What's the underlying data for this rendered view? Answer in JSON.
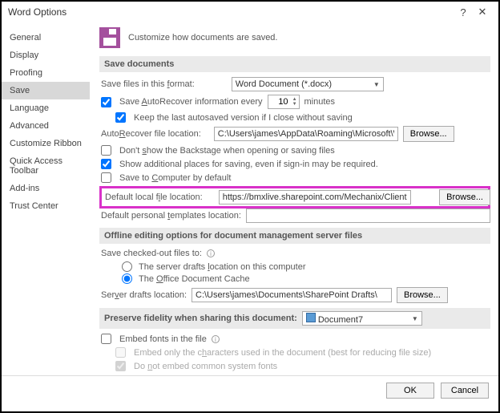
{
  "window": {
    "title": "Word Options"
  },
  "sidebar": {
    "items": [
      {
        "label": "General"
      },
      {
        "label": "Display"
      },
      {
        "label": "Proofing"
      },
      {
        "label": "Save"
      },
      {
        "label": "Language"
      },
      {
        "label": "Advanced"
      },
      {
        "label": "Customize Ribbon"
      },
      {
        "label": "Quick Access Toolbar"
      },
      {
        "label": "Add-ins"
      },
      {
        "label": "Trust Center"
      }
    ],
    "selected_index": 3
  },
  "header": {
    "text": "Customize how documents are saved."
  },
  "save_docs": {
    "title": "Save documents",
    "format_label": "Save files in this format:",
    "format_value": "Word Document (*.docx)",
    "autorecover_label_pre": "Save ",
    "autorecover_label_u": "A",
    "autorecover_label_post": "utoRecover information every",
    "autorecover_minutes": "10",
    "minutes_label": "minutes",
    "keep_last_label": "Keep the last autosaved version if I close without saving",
    "ar_loc_label_pre": "Auto",
    "ar_loc_label_u": "R",
    "ar_loc_label_post": "ecover file location:",
    "ar_loc_value": "C:\\Users\\james\\AppData\\Roaming\\Microsoft\\Word\\",
    "dont_show_pre": "Don't ",
    "dont_show_u": "s",
    "dont_show_post": "how the Backstage when opening or saving files",
    "show_additional": "Show additional places for saving, even if sign-in may be required.",
    "save_to_computer_pre": "Save to ",
    "save_to_computer_u": "C",
    "save_to_computer_post": "omputer by default",
    "default_local_pre": "Default local f",
    "default_local_u": "i",
    "default_local_post": "le location:",
    "default_local_value": "https://bmxlive.sharepoint.com/Mechanix/Clients/",
    "default_personal_pre": "Default personal ",
    "default_personal_u": "t",
    "default_personal_post": "emplates location:",
    "default_personal_value": "",
    "browse": "Browse..."
  },
  "offline": {
    "title": "Offline editing options for document management server files",
    "checked_out_label": "Save checked-out files to:",
    "opt_server_pre": "The server drafts ",
    "opt_server_u": "l",
    "opt_server_post": "ocation on this computer",
    "opt_cache_pre": "The ",
    "opt_cache_u": "O",
    "opt_cache_post": "ffice Document Cache",
    "drafts_label_pre": "Ser",
    "drafts_label_u": "v",
    "drafts_label_post": "er drafts location:",
    "drafts_value": "C:\\Users\\james\\Documents\\SharePoint Drafts\\",
    "browse": "Browse..."
  },
  "preserve": {
    "title": "Preserve fidelity when sharing this document:",
    "doc_value": "Document7",
    "embed_pre": "Embed fonts in the file",
    "embed_only_pre": "Embed only the c",
    "embed_only_u": "h",
    "embed_only_post": "aracters used in the document (best for reducing file size)",
    "not_common_pre": "Do ",
    "not_common_u": "n",
    "not_common_post": "ot embed common system fonts"
  },
  "footer": {
    "ok": "OK",
    "cancel": "Cancel"
  }
}
